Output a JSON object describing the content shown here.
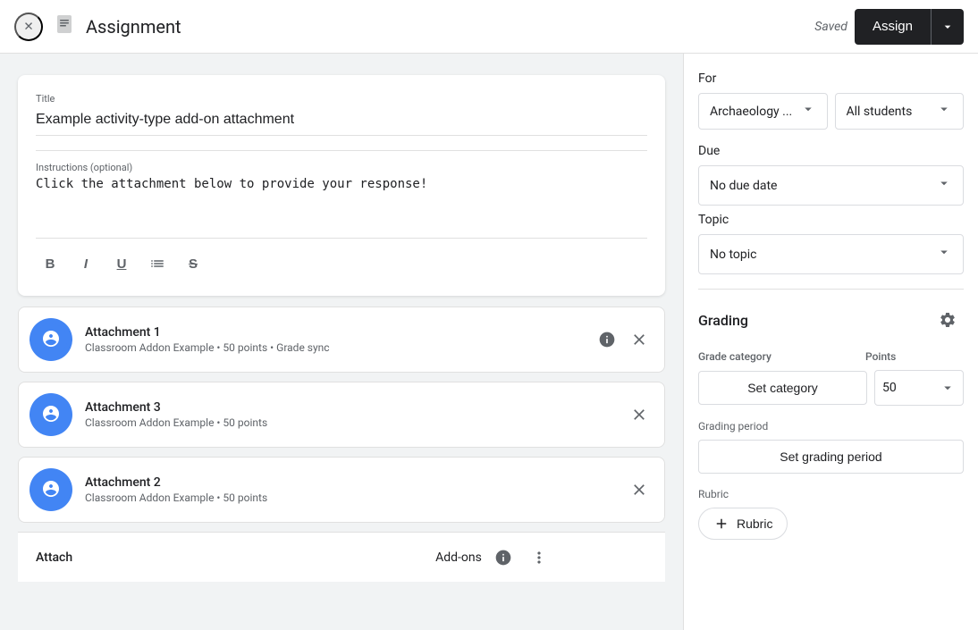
{
  "header": {
    "title": "Assignment",
    "saved_text": "Saved",
    "assign_label": "Assign",
    "close_icon": "✕",
    "doc_icon": "📋"
  },
  "assignment": {
    "title_label": "Title",
    "title_value": "Example activity-type add-on attachment",
    "instructions_label": "Instructions (optional)",
    "instructions_value": "Click the attachment below to provide your response!",
    "toolbar": {
      "bold": "B",
      "italic": "I",
      "underline": "U",
      "list": "≡",
      "strikethrough": "S̶"
    },
    "attachments": [
      {
        "name": "Attachment 1",
        "meta": "Classroom Addon Example • 50 points • Grade sync"
      },
      {
        "name": "Attachment 3",
        "meta": "Classroom Addon Example • 50 points"
      },
      {
        "name": "Attachment 2",
        "meta": "Classroom Addon Example • 50 points"
      }
    ]
  },
  "bottom_bar": {
    "attach_label": "Attach",
    "addons_label": "Add-ons"
  },
  "right_panel": {
    "for_label": "For",
    "class_value": "Archaeology ...",
    "students_value": "All students",
    "due_label": "Due",
    "due_value": "No due date",
    "topic_label": "Topic",
    "topic_value": "No topic",
    "grading_title": "Grading",
    "grade_category_label": "Grade category",
    "points_label": "Points",
    "set_category_label": "Set category",
    "points_value": "50",
    "grading_period_label": "Grading period",
    "set_period_label": "Set grading period",
    "rubric_label": "Rubric",
    "add_rubric_label": "Rubric"
  }
}
